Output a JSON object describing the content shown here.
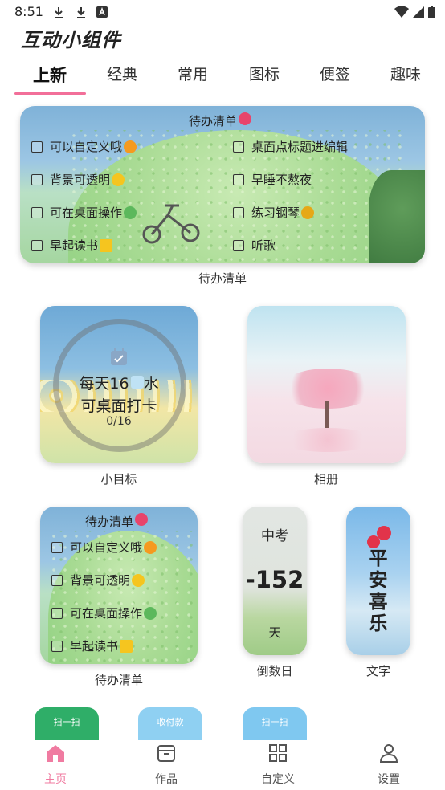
{
  "status": {
    "time": "8:51"
  },
  "app_title": "互动小组件",
  "tabs": [
    {
      "label": "上新",
      "active": true
    },
    {
      "label": "经典"
    },
    {
      "label": "常用"
    },
    {
      "label": "图标"
    },
    {
      "label": "便签"
    },
    {
      "label": "趣味"
    }
  ],
  "widget_large": {
    "title": "待办清单",
    "items_left": [
      "可以自定义哦",
      "背景可透明",
      "可在桌面操作",
      "早起读书"
    ],
    "items_right": [
      "桌面点标题进编辑",
      "早睡不熬夜",
      "练习钢琴",
      "听歌"
    ],
    "caption": "待办清单"
  },
  "widget_goal": {
    "line1": "每天16",
    "line1_suffix": "水",
    "line2": "可桌面打卡",
    "progress": "0/16",
    "caption": "小目标"
  },
  "widget_album": {
    "caption": "相册"
  },
  "widget_todo_small": {
    "title": "待办清单",
    "items": [
      "可以自定义哦",
      "背景可透明",
      "可在桌面操作",
      "早起读书"
    ],
    "caption": "待办清单"
  },
  "widget_countdown": {
    "label": "中考",
    "value": "-152",
    "unit": "天",
    "caption": "倒数日"
  },
  "widget_text": {
    "text": "平安喜乐",
    "caption": "文字"
  },
  "mini_cards": [
    {
      "label": "扫一扫",
      "color": "#2fae68"
    },
    {
      "label": "收付款",
      "color": "#8fd0f2"
    },
    {
      "label": "扫一扫",
      "color": "#7fc8f0"
    }
  ],
  "bottom_nav": [
    {
      "label": "主页",
      "active": true,
      "icon": "home-icon"
    },
    {
      "label": "作品",
      "icon": "box-icon"
    },
    {
      "label": "自定义",
      "icon": "grid-icon"
    },
    {
      "label": "设置",
      "icon": "person-icon"
    }
  ],
  "colors": {
    "accent": "#f26f99",
    "nav_active": "#f07ba1"
  }
}
